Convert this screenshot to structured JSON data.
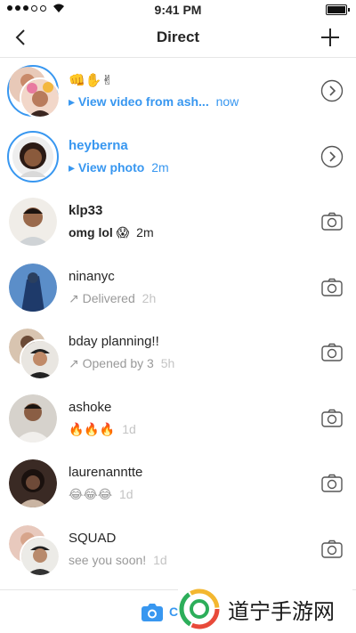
{
  "status_bar": {
    "time": "9:41 PM"
  },
  "header": {
    "title": "Direct"
  },
  "threads": [
    {
      "name": "👊✋✌",
      "subtitle": "▸ View video from ash...",
      "time": "now",
      "style": "unread-video"
    },
    {
      "name": "heyberna",
      "subtitle": "▸ View photo",
      "time": "2m",
      "style": "unread-photo"
    },
    {
      "name": "klp33",
      "subtitle": "omg lol 😱",
      "time": "2m",
      "style": "unread"
    },
    {
      "name": "ninanyc",
      "subtitle": "↗ Delivered",
      "time": "2h",
      "style": "read"
    },
    {
      "name": "bday planning!!",
      "subtitle": "↗ Opened by 3",
      "time": "5h",
      "style": "read"
    },
    {
      "name": "ashoke",
      "subtitle": "🔥🔥🔥",
      "time": "1d",
      "style": "read"
    },
    {
      "name": "laurenanntte",
      "subtitle": "😂😂😂",
      "time": "1d",
      "style": "read"
    },
    {
      "name": "SQUAD",
      "subtitle": "see you soon!",
      "time": "1d",
      "style": "read"
    }
  ],
  "bottom_bar": {
    "camera_label": "C"
  },
  "watermark": {
    "text": "道宁手游网"
  },
  "colors": {
    "accent": "#3897f0",
    "text": "#262626",
    "muted": "#999999"
  }
}
